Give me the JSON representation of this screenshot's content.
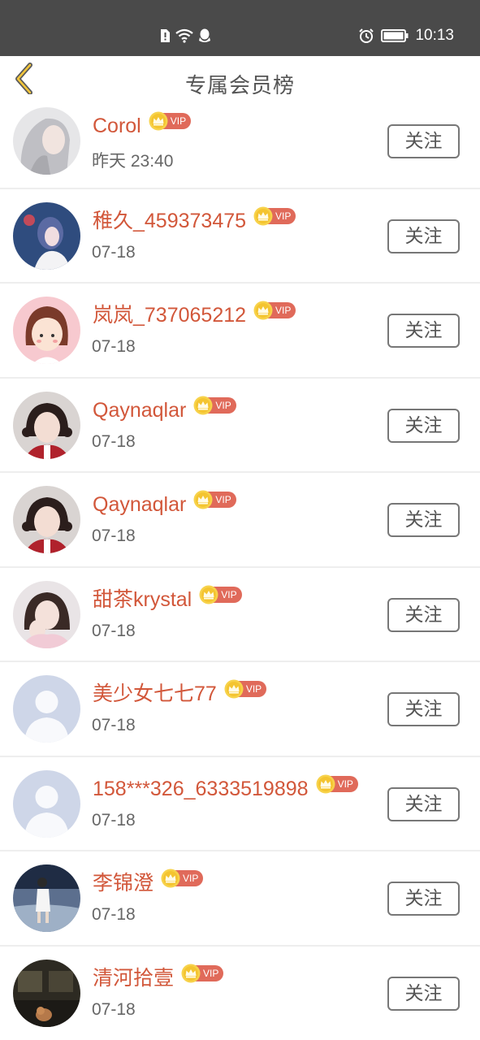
{
  "status_bar": {
    "time": "10:13"
  },
  "header": {
    "title": "专属会员榜"
  },
  "badge_label": "VIP",
  "follow_label": "关注",
  "colors": {
    "accent": "#d2573a",
    "vip": "#e06a5a",
    "crown": "#f4c430",
    "statusbar": "#4a4a4a"
  },
  "members": [
    {
      "name": "Corol",
      "date": "昨天 23:40",
      "avatar": "gray-hair-girl"
    },
    {
      "name": "稚久_459373475",
      "date": "07-18",
      "avatar": "blue-girl"
    },
    {
      "name": "岚岚_737065212",
      "date": "07-18",
      "avatar": "cartoon-girl"
    },
    {
      "name": "Qaynaqlar",
      "date": "07-18",
      "avatar": "girl-red"
    },
    {
      "name": "Qaynaqlar",
      "date": "07-18",
      "avatar": "girl-red"
    },
    {
      "name": "甜茶krystal",
      "date": "07-18",
      "avatar": "girl-pink"
    },
    {
      "name": "美少女七七77",
      "date": "07-18",
      "avatar": "default-user"
    },
    {
      "name": "158***326_6333519898",
      "date": "07-18",
      "avatar": "default-user"
    },
    {
      "name": "李锦澄",
      "date": "07-18",
      "avatar": "beach-person"
    },
    {
      "name": "清河拾壹",
      "date": "07-18",
      "avatar": "dark-room"
    }
  ]
}
